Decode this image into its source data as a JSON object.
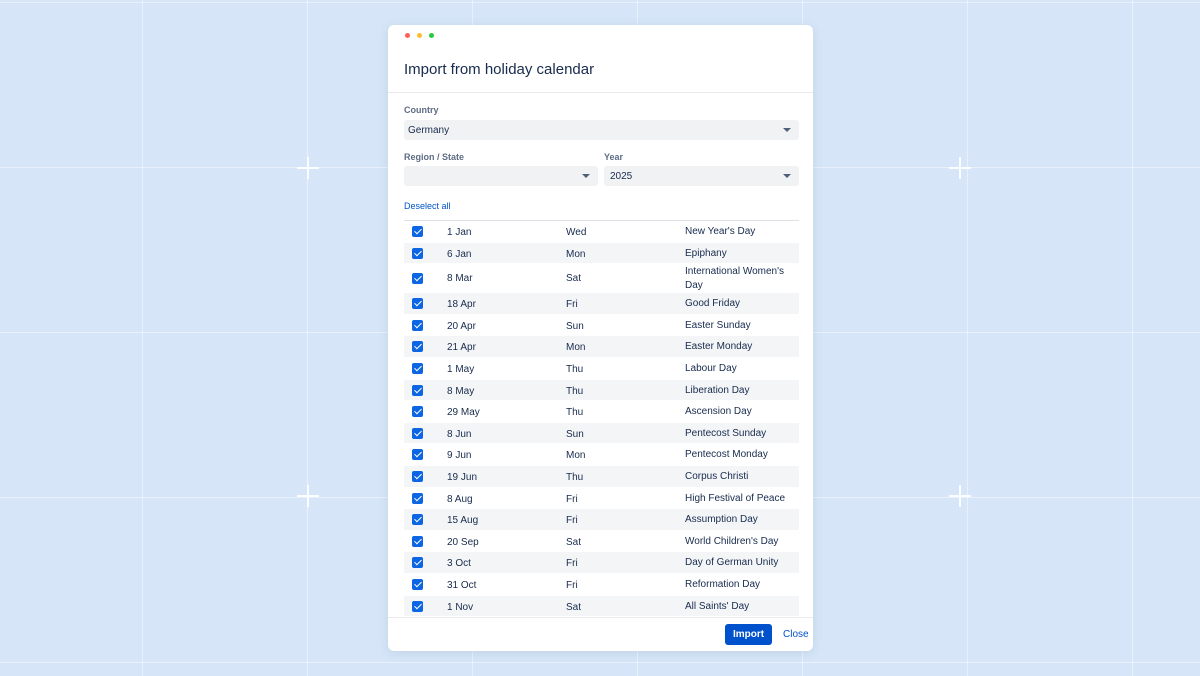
{
  "dialog": {
    "title": "Import from holiday calendar"
  },
  "form": {
    "country_label": "Country",
    "country_value": "Germany",
    "region_label": "Region / State",
    "region_value": "",
    "year_label": "Year",
    "year_value": "2025"
  },
  "list": {
    "deselect_label": "Deselect all",
    "holidays": [
      {
        "date": "1 Jan",
        "day": "Wed",
        "name": "New Year's Day"
      },
      {
        "date": "6 Jan",
        "day": "Mon",
        "name": "Epiphany"
      },
      {
        "date": "8 Mar",
        "day": "Sat",
        "name": "International Women's Day"
      },
      {
        "date": "18 Apr",
        "day": "Fri",
        "name": "Good Friday"
      },
      {
        "date": "20 Apr",
        "day": "Sun",
        "name": "Easter Sunday"
      },
      {
        "date": "21 Apr",
        "day": "Mon",
        "name": "Easter Monday"
      },
      {
        "date": "1 May",
        "day": "Thu",
        "name": "Labour Day"
      },
      {
        "date": "8 May",
        "day": "Thu",
        "name": "Liberation Day"
      },
      {
        "date": "29 May",
        "day": "Thu",
        "name": "Ascension Day"
      },
      {
        "date": "8 Jun",
        "day": "Sun",
        "name": "Pentecost Sunday"
      },
      {
        "date": "9 Jun",
        "day": "Mon",
        "name": "Pentecost Monday"
      },
      {
        "date": "19 Jun",
        "day": "Thu",
        "name": "Corpus Christi"
      },
      {
        "date": "8 Aug",
        "day": "Fri",
        "name": "High Festival of Peace"
      },
      {
        "date": "15 Aug",
        "day": "Fri",
        "name": "Assumption Day"
      },
      {
        "date": "20 Sep",
        "day": "Sat",
        "name": "World Children's Day"
      },
      {
        "date": "3 Oct",
        "day": "Fri",
        "name": "Day of German Unity"
      },
      {
        "date": "31 Oct",
        "day": "Fri",
        "name": "Reformation Day"
      },
      {
        "date": "1 Nov",
        "day": "Sat",
        "name": "All Saints' Day"
      }
    ]
  },
  "footer": {
    "import_label": "Import",
    "close_label": "Close"
  },
  "colors": {
    "accent": "#0052cc",
    "checkbox": "#0c66e4",
    "background": "#d6e6f8"
  }
}
